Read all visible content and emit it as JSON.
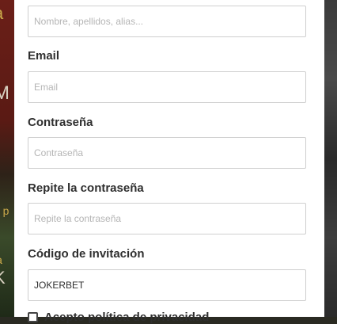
{
  "background": {
    "fragments": [
      "a",
      "M",
      "e p",
      "la",
      "K"
    ]
  },
  "form": {
    "name_field": {
      "placeholder": "Nombre, apellidos, alias..."
    },
    "email": {
      "label": "Email",
      "placeholder": "Email"
    },
    "password": {
      "label": "Contraseña",
      "placeholder": "Contraseña"
    },
    "repeat_password": {
      "label": "Repite la contraseña",
      "placeholder": "Repite la contraseña"
    },
    "invitation_code": {
      "label": "Código de invitación",
      "value": "JOKERBET"
    },
    "terms_checkbox": {
      "label": "Acepto política de privacidad"
    }
  }
}
